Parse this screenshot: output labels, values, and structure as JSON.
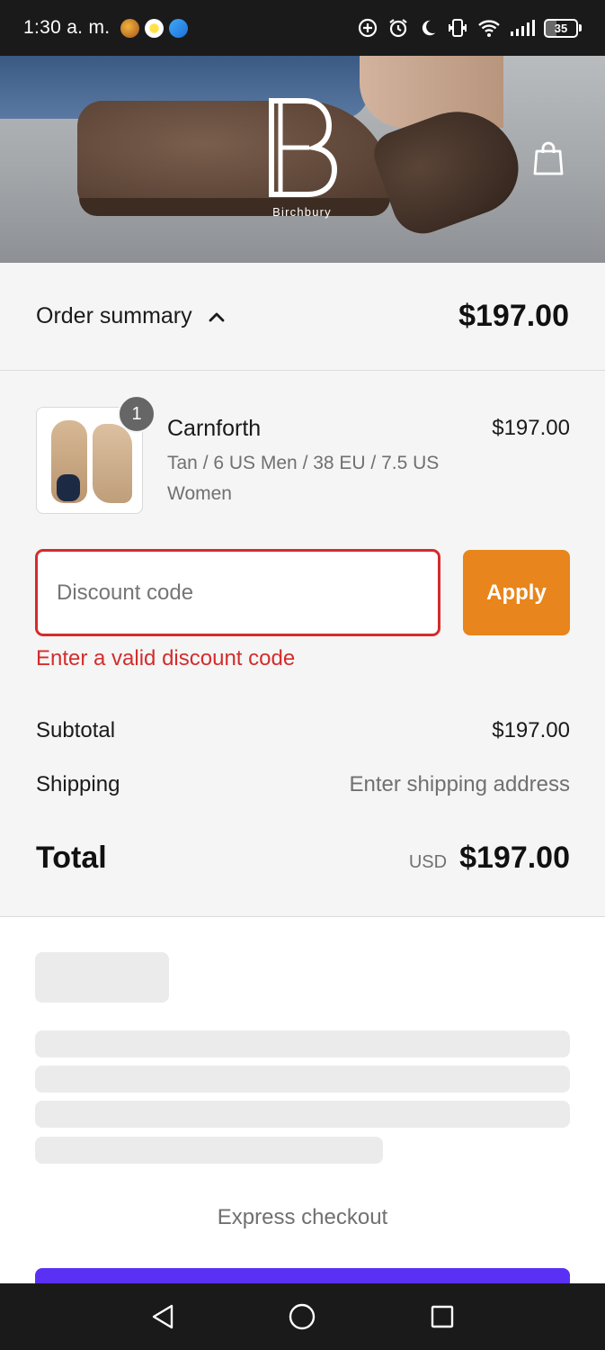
{
  "status_bar": {
    "time": "1:30 a. m.",
    "battery_percent": "35",
    "notification_icons": [
      "app-notification-icon",
      "bee-app-icon",
      "messenger-icon"
    ],
    "system_icons": [
      "data-saver-icon",
      "alarm-icon",
      "do-not-disturb-icon",
      "vibrate-icon",
      "wifi-icon",
      "signal-icon",
      "battery-icon"
    ]
  },
  "header": {
    "brand": "Birchbury",
    "cart_icon": "shopping-bag-icon"
  },
  "order_summary": {
    "label": "Order summary",
    "toggle_icon": "chevron-up-icon",
    "total": "$197.00"
  },
  "line_item": {
    "quantity": "1",
    "name": "Carnforth",
    "variant": "Tan / 6 US Men / 38 EU / 7.5 US Women",
    "price": "$197.00"
  },
  "discount": {
    "placeholder": "Discount code",
    "value": "",
    "apply_label": "Apply",
    "error": "Enter a valid discount code"
  },
  "totals": {
    "subtotal_label": "Subtotal",
    "subtotal_value": "$197.00",
    "shipping_label": "Shipping",
    "shipping_value": "Enter shipping address",
    "total_label": "Total",
    "currency": "USD",
    "total_value": "$197.00"
  },
  "express": {
    "label": "Express checkout"
  },
  "colors": {
    "accent_orange": "#e8851c",
    "error_red": "#d42c2c",
    "express_purple": "#5a31f4",
    "panel_bg": "#f5f5f5"
  }
}
